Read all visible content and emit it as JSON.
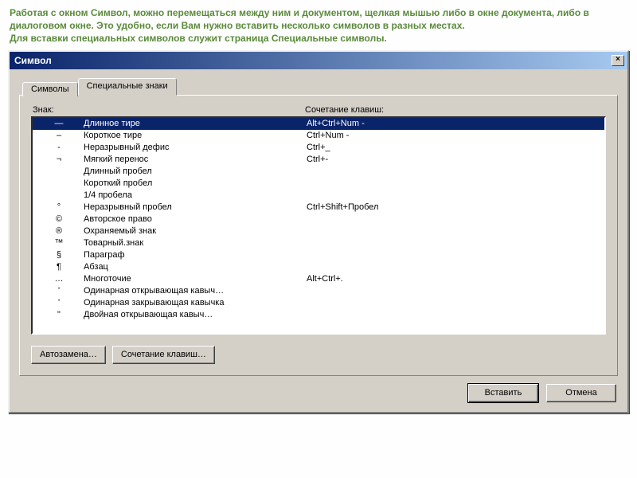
{
  "intro": {
    "p1": "Работая с окном Символ, можно перемещаться между ним и документом, щелкая мышью либо в окне документа, либо в диалоговом окне. Это удобно, если Вам нужно вставить несколько символов в разных местах.",
    "p2": "Для вставки специальных символов служит страница Специальные символы."
  },
  "dialog": {
    "title": "Символ",
    "tabs": {
      "symbols": "Символы",
      "special": "Специальные знаки"
    },
    "headers": {
      "sign": "Знак:",
      "shortcut": "Сочетание клавиш:"
    },
    "rows": [
      {
        "sym": "—",
        "name": "Длинное тире",
        "shortcut": "Alt+Ctrl+Num -",
        "selected": true
      },
      {
        "sym": "–",
        "name": "Короткое тире",
        "shortcut": "Ctrl+Num -"
      },
      {
        "sym": "-",
        "name": "Неразрывный дефис",
        "shortcut": "Ctrl+_"
      },
      {
        "sym": "¬",
        "name": "Мягкий перенос",
        "shortcut": "Ctrl+-"
      },
      {
        "sym": "",
        "name": "Длинный пробел",
        "shortcut": ""
      },
      {
        "sym": "",
        "name": "Короткий пробел",
        "shortcut": ""
      },
      {
        "sym": "",
        "name": "1/4 пробела",
        "shortcut": ""
      },
      {
        "sym": "°",
        "name": "Неразрывный пробел",
        "shortcut": "Ctrl+Shift+Пробел"
      },
      {
        "sym": "©",
        "name": "Авторское право",
        "shortcut": ""
      },
      {
        "sym": "®",
        "name": "Охраняемый знак",
        "shortcut": ""
      },
      {
        "sym": "™",
        "name": "Товарный.знак",
        "shortcut": ""
      },
      {
        "sym": "§",
        "name": "Параграф",
        "shortcut": ""
      },
      {
        "sym": "¶",
        "name": "Абзац",
        "shortcut": ""
      },
      {
        "sym": "…",
        "name": "Многоточие",
        "shortcut": "Alt+Ctrl+."
      },
      {
        "sym": "'",
        "name": "Одинарная открывающая кавыч…",
        "shortcut": ""
      },
      {
        "sym": "'",
        "name": "Одинарная закрывающая кавычка",
        "shortcut": ""
      },
      {
        "sym": "\"",
        "name": "Двойная открывающая кавыч…",
        "shortcut": ""
      }
    ],
    "buttons": {
      "autocorrect": "Автозамена…",
      "shortcut": "Сочетание клавиш…",
      "insert": "Вставить",
      "cancel": "Отмена"
    }
  }
}
